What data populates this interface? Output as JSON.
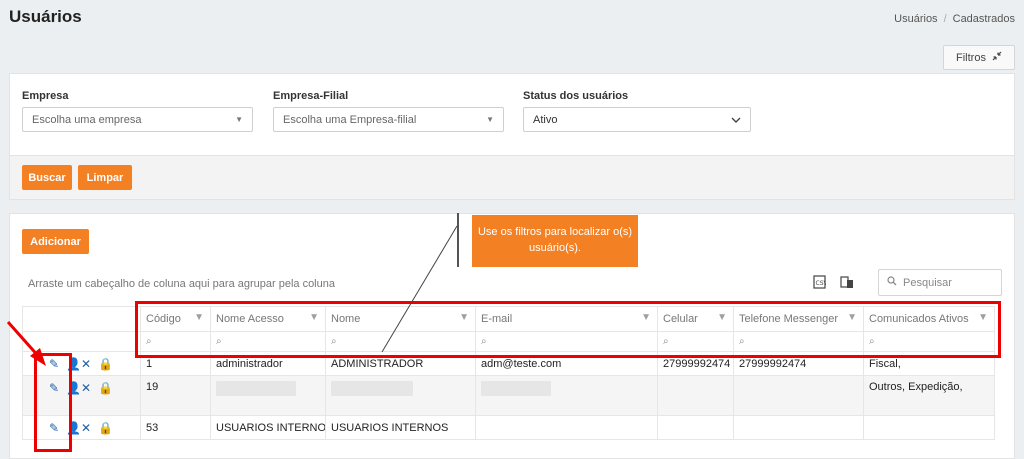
{
  "page": {
    "title": "Usuários",
    "breadcrumb": [
      "Usuários",
      "Cadastrados"
    ],
    "filters_button": "Filtros"
  },
  "filters": {
    "empresa": {
      "label": "Empresa",
      "placeholder": "Escolha uma empresa"
    },
    "empresa_filial": {
      "label": "Empresa-Filial",
      "placeholder": "Escolha uma Empresa-filial"
    },
    "status": {
      "label": "Status dos usuários",
      "value": "Ativo"
    }
  },
  "actions": {
    "search": "Buscar",
    "clear": "Limpar"
  },
  "grid": {
    "add_button": "Adicionar",
    "group_hint": "Arraste um cabeçalho de coluna aqui para agrupar pela coluna",
    "search_placeholder": "Pesquisar",
    "columns": [
      "Código",
      "Nome Acesso",
      "Nome",
      "E-mail",
      "Celular",
      "Telefone Messenger",
      "Comunicados Ativos"
    ],
    "rows": [
      {
        "codigo": "1",
        "nome_acesso": "administrador",
        "nome": "ADMINISTRADOR",
        "email": "adm@teste.com",
        "celular": "27999992474",
        "telefone": "27999992474",
        "comunicados": "Fiscal,"
      },
      {
        "codigo": "19",
        "nome_acesso": "",
        "nome": "",
        "email": "",
        "celular": "",
        "telefone": "",
        "comunicados": "Outros, Expedição,"
      },
      {
        "codigo": "53",
        "nome_acesso": "USUARIOS INTERNOS",
        "nome": "USUARIOS INTERNOS",
        "email": "",
        "celular": "",
        "telefone": "",
        "comunicados": ""
      }
    ]
  },
  "callout": {
    "text": "Use os filtros para localizar o(s) usuário(s)."
  },
  "colors": {
    "accent": "#f48024",
    "highlight": "#e00000",
    "edit_icon": "#1e5fa8"
  }
}
